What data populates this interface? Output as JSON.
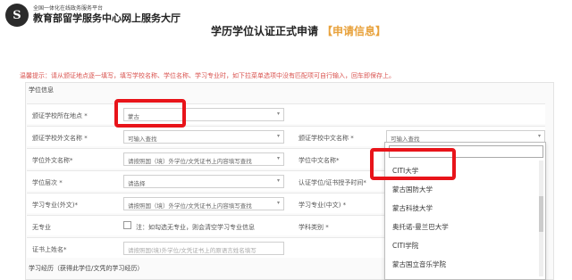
{
  "header": {
    "logo_glyph": "S",
    "logo_small": "全国一体化在线政务服务平台",
    "logo_big": "教育部留学服务中心网上服务大厅",
    "title": "学历学位认证正式申请",
    "title_tag": "【申请信息】"
  },
  "tip": "温馨提示：请从颁证地点逐一填写，填写学校名称、学位名称、学习专业时，如下拉菜单选项中没有匹配项可自行输入，回车即保存上。",
  "sections": {
    "degree_info": "学位信息",
    "study_history": "学习经历（获得此学位/文凭的学习经历）"
  },
  "form": {
    "location": {
      "label": "颁证学校所在地点 *",
      "value": "蒙古"
    },
    "foreign_name": {
      "label": "颁证学校外文名称 *",
      "value": "可输入查找"
    },
    "cn_name": {
      "label": "颁证学校中文名称 *",
      "value": "可输入查找"
    },
    "degree_foreign": {
      "label": "学位外文名称*",
      "value": "请按照国（境）外学位/文凭证书上内容填写查找"
    },
    "degree_cn": {
      "label": "学位中文名称*"
    },
    "degree_level": {
      "label": "学位层次 *",
      "value": "请选择"
    },
    "cert_date": {
      "label": "认证学位/证书授予时间*"
    },
    "major_foreign": {
      "label": "学习专业(外文)*",
      "value": "请按照国（境）外学位/文凭证书上内容填写查找"
    },
    "major_cn": {
      "label": "学习专业(中文) *"
    },
    "no_major": {
      "label": "无专业",
      "note": "注：如勾选无专业，则会清空学习专业信息"
    },
    "discipline": {
      "label": "学科类别 *"
    },
    "cert_name": {
      "label": "证书上姓名*",
      "value": "请按照国(境)外学位/文凭证书上的原语言姓名填写"
    }
  },
  "dropdown": {
    "search_value": "",
    "options": [
      "CITI大学",
      "蒙古国防大学",
      "蒙古科技大学",
      "奥托诺-曼兰巴大学",
      "CITI学院",
      "蒙古国立音乐学院"
    ]
  },
  "colors": {
    "highlight": "#e8141a",
    "tag": "#e8a23c",
    "tip": "#d9534f"
  }
}
